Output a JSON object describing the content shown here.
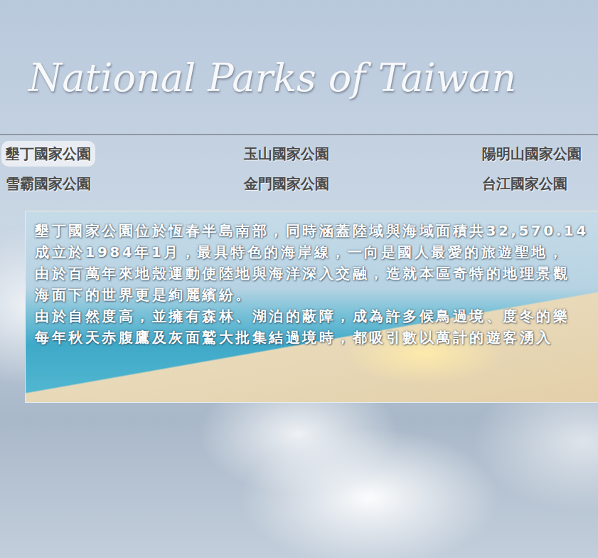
{
  "title": "National Parks of Taiwan",
  "nav": [
    {
      "label": "墾丁國家公園",
      "selected": true
    },
    {
      "label": "玉山國家公園",
      "selected": false
    },
    {
      "label": "陽明山國家公園",
      "selected": false
    },
    {
      "label": "雪霸國家公園",
      "selected": false
    },
    {
      "label": "金門國家公園",
      "selected": false
    },
    {
      "label": "台江國家公園",
      "selected": false
    }
  ],
  "article": {
    "lines": [
      "墾丁國家公園位於恆春半島南部，同時涵蓋陸域與海域面積共32,570.14",
      "成立於1984年1月，最具特色的海岸線，一向是國人最愛的旅遊聖地，",
      "由於百萬年來地殼運動使陸地與海洋深入交融，造就本區奇特的地理景觀",
      "海面下的世界更是絢麗繽紛。",
      "由於自然度高，並擁有森林、湖泊的蔽障，成為許多候鳥過境、度冬的樂",
      "每年秋天赤腹鷹及灰面鷲大批集結過境時，都吸引數以萬計的遊客湧入"
    ]
  }
}
